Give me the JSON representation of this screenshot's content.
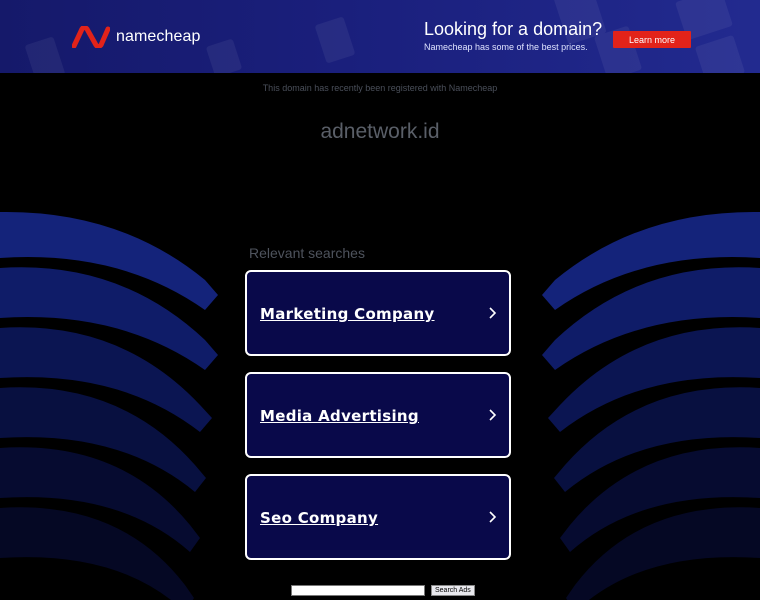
{
  "banner": {
    "brand": "namecheap",
    "promo_title": "Looking for a domain?",
    "promo_subtitle": "Namecheap has some of the best prices.",
    "cta_label": "Learn more",
    "logo_color": "#e2231a",
    "background_color": "#1a1f7c"
  },
  "notice": "This domain has recently been registered with Namecheap",
  "domain": "adnetwork.id",
  "relevant_searches": {
    "heading": "Relevant searches",
    "items": [
      {
        "label": "Marketing Company",
        "icon": "chevron-right-icon"
      },
      {
        "label": "Media Advertising",
        "icon": "chevron-right-icon"
      },
      {
        "label": "Seo Company",
        "icon": "chevron-right-icon"
      }
    ]
  },
  "search": {
    "placeholder": "",
    "button_label": "Search Ads"
  }
}
